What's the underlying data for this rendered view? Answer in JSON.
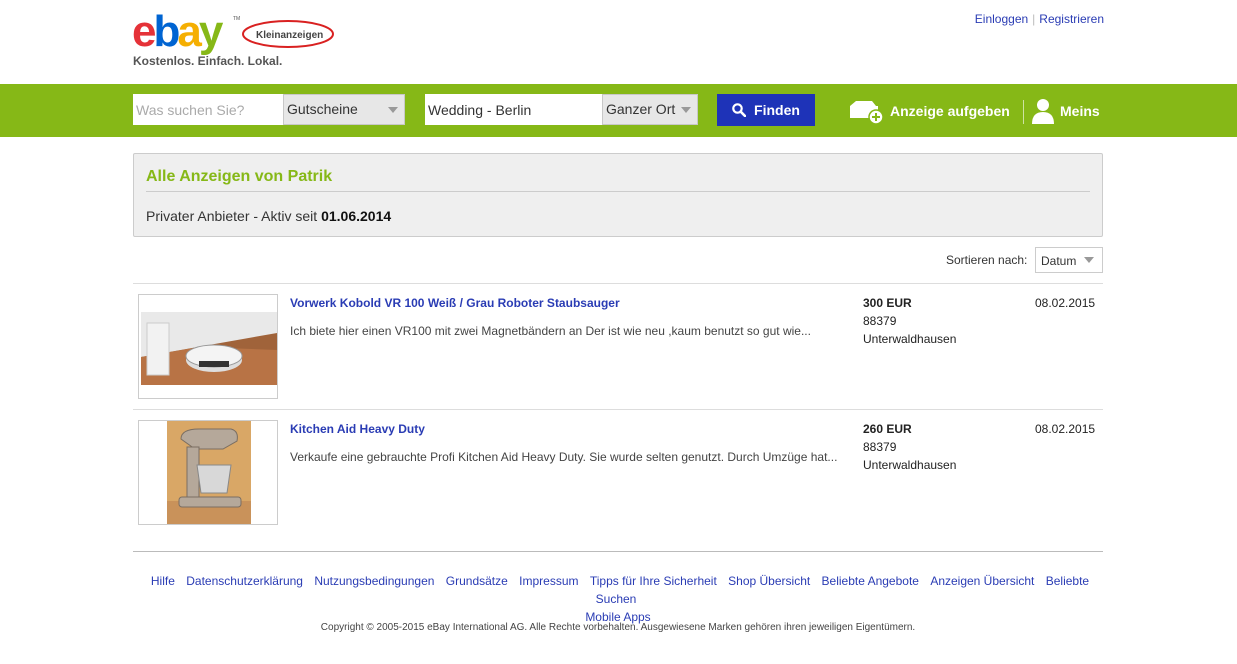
{
  "header": {
    "logo_text": "ebay",
    "logo_badge": "Kleinanzeigen",
    "tagline": "Kostenlos. Einfach. Lokal.",
    "login_label": "Einloggen",
    "register_label": "Registrieren"
  },
  "search": {
    "query_placeholder": "Was suchen Sie?",
    "category_value": "Gutscheine",
    "location_value": "Wedding - Berlin",
    "radius_value": "Ganzer Ort",
    "find_label": "Finden",
    "post_ad_label": "Anzeige aufgeben",
    "meins_label": "Meins"
  },
  "profile": {
    "title": "Alle Anzeigen von Patrik",
    "subtitle_prefix": "Privater Anbieter - Aktiv seit ",
    "active_since": "01.06.2014"
  },
  "sort": {
    "label": "Sortieren nach:",
    "value": "Datum"
  },
  "ads": [
    {
      "title": "Vorwerk Kobold VR 100 Weiß / Grau Roboter Staubsauger",
      "description": "Ich biete hier einen VR100 mit zwei Magnetbändern an Der ist wie neu ,kaum benutzt so gut wie...",
      "price": "300 EUR",
      "zip": "88379",
      "city": "Unterwaldhausen",
      "date": "08.02.2015"
    },
    {
      "title": "Kitchen Aid Heavy Duty",
      "description": "Verkaufe eine gebrauchte Profi Kitchen Aid Heavy Duty. Sie wurde selten genutzt. Durch Umzüge hat...",
      "price": "260 EUR",
      "zip": "88379",
      "city": "Unterwaldhausen",
      "date": "08.02.2015"
    }
  ],
  "footer": {
    "links": [
      "Hilfe",
      "Datenschutzerklärung",
      "Nutzungsbedingungen",
      "Grundsätze",
      "Impressum",
      "Tipps für Ihre Sicherheit",
      "Shop Übersicht",
      "Beliebte Angebote",
      "Anzeigen Übersicht",
      "Beliebte Suchen",
      "Mobile Apps"
    ],
    "copyright": "Copyright © 2005-2015 eBay International AG. Alle Rechte vorbehalten. Ausgewiesene Marken gehören ihren jeweiligen Eigentümern."
  },
  "colors": {
    "brand_green": "#86b817",
    "button_blue": "#1e33b8",
    "link_blue": "#2a3cb4"
  }
}
